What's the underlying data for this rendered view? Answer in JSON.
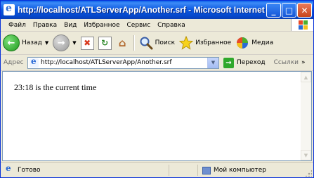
{
  "window": {
    "title": "http://localhost/ATLServerApp/Another.srf - Microsoft Internet E...",
    "buttons": {
      "minimize": "_",
      "maximize": "□",
      "close": "✕"
    }
  },
  "menu": {
    "items": [
      {
        "label": "Файл"
      },
      {
        "label": "Правка"
      },
      {
        "label": "Вид"
      },
      {
        "label": "Избранное"
      },
      {
        "label": "Сервис"
      },
      {
        "label": "Справка"
      }
    ]
  },
  "toolbar": {
    "back_label": "Назад",
    "search_label": "Поиск",
    "favorites_label": "Избранное",
    "media_label": "Медиа"
  },
  "address_bar": {
    "label": "Адрес",
    "value": "http://localhost/ATLServerApp/Another.srf",
    "go_label": "Переход",
    "links_label": "Ссылки",
    "links_arrow": "»"
  },
  "page": {
    "text": "23:18 is the current time"
  },
  "status_bar": {
    "text": "Готово",
    "zone": "Мой компьютер"
  },
  "colors": {
    "titlebar": "#0b58e0",
    "chrome": "#ece9d8",
    "go_green": "#2fa82c"
  }
}
